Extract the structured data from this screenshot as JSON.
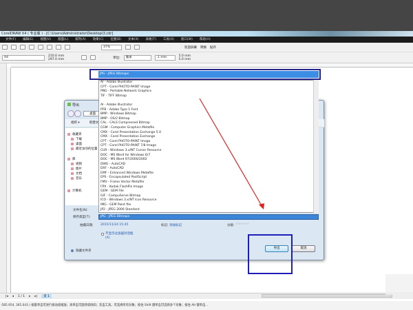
{
  "app": {
    "title": "CorelDRAW X4 ( 专业版 ) - [C:\\Users\\Administrator\\Desktop\\3.cdr]"
  },
  "menu": [
    "文件(F)",
    "编辑(E)",
    "视图(V)",
    "版面(L)",
    "排列(A)",
    "效果(C)",
    "位图(B)",
    "文本(X)",
    "表格(T)",
    "工具(O)",
    "窗口(W)",
    "帮助(H)"
  ],
  "toolbar": {
    "zoom": "37%",
    "snap": "贴齐",
    "transform": "转换",
    "welcome": "欢迎屏幕"
  },
  "propbar": {
    "page_size": "A4",
    "width": "210.0 mm",
    "height": "297.0 mm",
    "units_label": "单位:",
    "units": "毫米",
    "nudge": ".1 mm",
    "dup_x": "5.0 mm",
    "dup_y": "5.0 mm"
  },
  "pagenav": {
    "counter": "1 / 1",
    "page_tab": "页 1"
  },
  "status": {
    "text": "-585.954, 365.043 )  接着单击可进行拖动或缩放；再单击可旋转或倾斜；双击工具，可选择所有对象；按住 Shift 键单击可选择多个对象；按住 Alt 键单击..."
  },
  "dialog": {
    "title": "导出",
    "address": "桌面",
    "organize": "组织 ▾",
    "new_folder": "新建文件夹",
    "nav": [
      "收藏夹",
      "下载",
      "桌面",
      "最近访问的位置",
      "库",
      "视频",
      "图片",
      "文档",
      "音乐",
      "计算机"
    ],
    "filename_label": "文件名(N):",
    "filename_value": "JP2 - JPEG 2000 Standard",
    "filetype_label": "保存类型(T):",
    "filetype_value": "JPG - JPEG Bitmaps",
    "date_label": "拍摄日期:",
    "date_value": "2015/11/24 15:45",
    "tags_label": "标记:",
    "tags_value": "添加标记",
    "rating_label": "分级:",
    "rating_value": "☆☆☆☆☆",
    "checkbox_label": "不显示过滤器对话框",
    "checkbox_sub": "(A)",
    "hide_folders": "隐藏文件夹",
    "export": "导出",
    "cancel": "取消"
  },
  "dropdown": {
    "selected": "JPG - JPEG Bitmaps",
    "items": [
      "AI - Adobe Illustrator",
      "CPT - Corel PHOTO-PAINT Image",
      "PNG - Portable Network Graphics",
      "TIF - TIFF Bitmap",
      "",
      "AI - Adobe Illustrator",
      "PFB - Adobe Type 1 Font",
      "BMP - Windows Bitmap",
      "BMP - OS/2 Bitmap",
      "CAL - CALS Compressed Bitmap",
      "CGM - Computer Graphics Metafile",
      "CMX - Corel Presentation Exchange 5.0",
      "CMX - Corel Presentation Exchange",
      "CPT - Corel PHOTO-PAINT Image",
      "CPT - Corel PHOTO-PAINT 7/8 Image",
      "CUR - Windows 3.x/NT Cursor Resource",
      "DOC - MS Word for Windows 6/7",
      "DOC - MS Word 97/2000/2002",
      "DWG - AutoCAD",
      "DXF - AutoCAD",
      "EMF - Enhanced Windows Metafile",
      "EPS - Encapsulated PostScript",
      "FMV - Frame Vector Metafile",
      "FPX - Kodak FlashPix Image",
      "GEM - GEM File",
      "GIF - CompuServe Bitmap",
      "ICO - Windows 3.x/NT Icon Resource",
      "IMG - GEM Paint file",
      "JP2 - JPEG 2000 Standard"
    ]
  },
  "colors": {
    "annotation_blue": "#1d1db8",
    "arrow_red": "#e02020",
    "selection": "#3b8ee3"
  }
}
